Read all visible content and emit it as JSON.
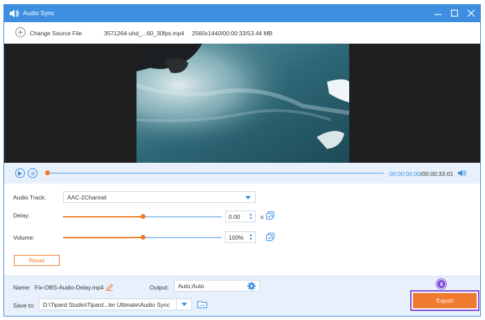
{
  "window": {
    "title": "Audio Sync"
  },
  "toolbar": {
    "change_source": "Change Source File",
    "file_name": "3571264-uhd_...60_30fps.mp4",
    "file_meta": "2560x1440/00:00:33/53.44 MB"
  },
  "playback": {
    "current_time": "00:00:00.00",
    "total_time": "/00:00:33.01",
    "progress": 0
  },
  "settings": {
    "audio_track_label": "Audio Track:",
    "audio_track_value": "AAC-2Channel",
    "delay_label": "Delay:",
    "delay_value": "0.00",
    "delay_unit": "s",
    "delay_level": 0.5,
    "volume_label": "Volume:",
    "volume_value": "100%",
    "volume_level": 0.5,
    "reset_label": "Reset"
  },
  "bottom": {
    "name_label": "Name:",
    "name_value": "Fix-OBS-Audio-Delay.mp4",
    "output_label": "Output:",
    "output_value": "Auto;Auto",
    "save_label": "Save to:",
    "save_value": "D:\\Tipard Studio\\Tipard...ter Ultimate\\Audio Sync",
    "export_label": "Export",
    "step_badge": "4"
  },
  "colors": {
    "accent": "#3d8ee0",
    "orange": "#f07a2e",
    "highlight": "#7b4ae0"
  }
}
